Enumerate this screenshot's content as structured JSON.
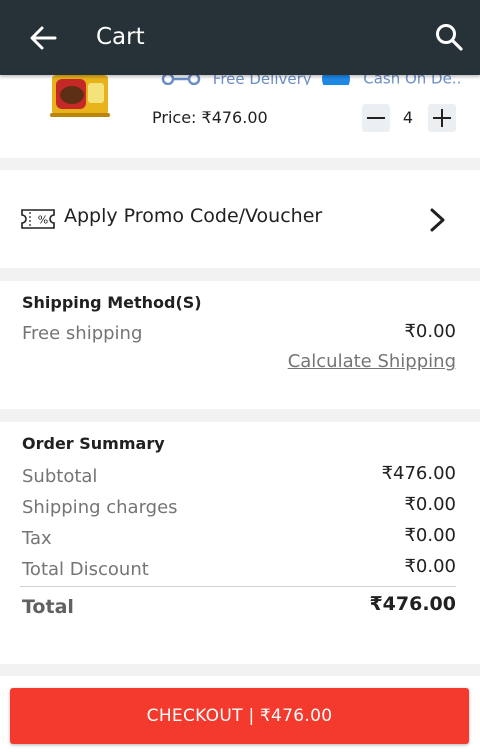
{
  "header": {
    "title": "Cart",
    "back_icon": "arrow-left-icon",
    "search_icon": "search-icon"
  },
  "product": {
    "delivery": "Free Delivery",
    "payment": "Cash On De...",
    "price_label": "Price: ₹476.00",
    "quantity": "4"
  },
  "promo": {
    "label": "Apply Promo Code/Voucher"
  },
  "shipping": {
    "title": "Shipping Method(S)",
    "method": "Free shipping",
    "cost": "₹0.00",
    "calculate": "Calculate Shipping"
  },
  "summary": {
    "title": "Order Summary",
    "rows": [
      {
        "label": "Subtotal",
        "value": "₹476.00"
      },
      {
        "label": "Shipping charges",
        "value": "₹0.00"
      },
      {
        "label": "Tax",
        "value": "₹0.00"
      },
      {
        "label": "Total Discount",
        "value": "₹0.00"
      }
    ],
    "total_label": "Total",
    "total_value": "₹476.00"
  },
  "checkout": {
    "label": "CHECKOUT |",
    "amount": "₹476.00"
  },
  "colors": {
    "topbar": "#263238",
    "checkout": "#f4392d",
    "accent_blue": "#1e88e5"
  }
}
